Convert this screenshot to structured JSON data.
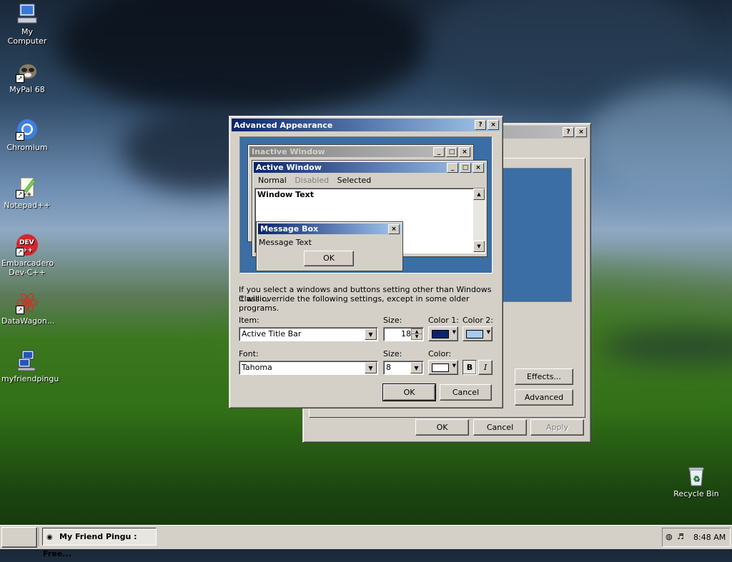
{
  "desktop": {
    "icons": [
      {
        "label": "My Computer",
        "icon": "computer-icon"
      },
      {
        "label": "MyPal 68",
        "icon": "mypal-raccoon-icon"
      },
      {
        "label": "Chromium",
        "icon": "chromium-icon"
      },
      {
        "label": "Notepad++",
        "icon": "notepadpp-icon"
      },
      {
        "label": "Embarcadero Dev-C++",
        "icon": "devcpp-icon"
      },
      {
        "label": "DataWagon...",
        "icon": "datawagon-icon"
      },
      {
        "label": "myfriendpingu",
        "icon": "pingu-app-icon"
      },
      {
        "label": "Recycle Bin",
        "icon": "recycle-bin-icon"
      }
    ]
  },
  "back_window": {
    "effects_label": "Effects...",
    "advanced_label": "Advanced",
    "ok_label": "OK",
    "cancel_label": "Cancel",
    "apply_label": "Apply"
  },
  "dialog": {
    "title": "Advanced Appearance",
    "preview": {
      "inactive_title": "Inactive Window",
      "active_title": "Active Window",
      "menu_normal": "Normal",
      "menu_disabled": "Disabled",
      "menu_selected": "Selected",
      "window_text": "Window Text",
      "msgbox_title": "Message Box",
      "msgbox_text": "Message Text",
      "msgbox_ok": "OK"
    },
    "info_text_line1": "If you select a windows and buttons setting other than Windows Classic,",
    "info_text_line2": "it will override the following settings, except in some older programs.",
    "item_label": "Item:",
    "item_value": "Active Title Bar",
    "size_label": "Size:",
    "size_value": "18",
    "color1_label": "Color 1:",
    "color2_label": "Color 2:",
    "color1": "#0a246a",
    "color2": "#a6caf0",
    "font_label": "Font:",
    "font_value": "Tahoma",
    "font_size_label": "Size:",
    "font_size_value": "8",
    "font_color_label": "Color:",
    "font_color": "#ffffff",
    "bold_label": "B",
    "italic_label": "I",
    "ok_label": "OK",
    "cancel_label": "Cancel",
    "help_glyph": "?",
    "close_glyph": "×"
  },
  "taskbar": {
    "task_label": "My Friend Pingu : Free...",
    "clock": "8:48 AM"
  }
}
